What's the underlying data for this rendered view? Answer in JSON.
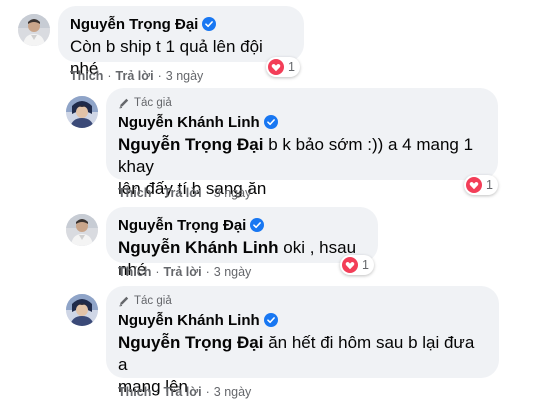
{
  "comments": [
    {
      "author": "Nguyễn Trọng Đại",
      "author_tag": "",
      "mention": "",
      "text": "Còn b ship t 1 quả lên đội nhé",
      "like_label": "Thích",
      "reply_label": "Trả lời",
      "time": "3 ngày",
      "reactions": "1"
    },
    {
      "author": "Nguyễn Khánh Linh",
      "author_tag": "Tác giả",
      "mention": "Nguyễn Trọng Đại",
      "text": "b k bảo sớm :)) a 4 mang 1 khay lên đấy tí b sang ăn",
      "text_line1": "b k bảo sớm :)) a 4 mang 1 khay",
      "text_line2": "lên đấy tí b sang ăn",
      "like_label": "Thích",
      "reply_label": "Trả lời",
      "time": "3 ngày",
      "reactions": "1"
    },
    {
      "author": "Nguyễn Trọng Đại",
      "author_tag": "",
      "mention": "Nguyễn Khánh Linh",
      "text": "oki , hsau nhé",
      "like_label": "Thích",
      "reply_label": "Trả lời",
      "time": "3 ngày",
      "reactions": "1"
    },
    {
      "author": "Nguyễn Khánh Linh",
      "author_tag": "Tác giả",
      "mention": "Nguyễn Trọng Đại",
      "text_line1": "ăn hết đi hôm sau b lại đưa a",
      "text_line2": "mang lên",
      "like_label": "Thích",
      "reply_label": "Trả lời",
      "time": "3 ngày"
    }
  ],
  "separator": "·",
  "colors": {
    "bubble": "#f0f2f5",
    "verified": "#1877f2",
    "heart": "#f33e58",
    "secondary_text": "#65676b"
  },
  "icons": [
    "verified-badge-icon",
    "author-pen-icon",
    "heart-reaction-icon",
    "avatar"
  ]
}
